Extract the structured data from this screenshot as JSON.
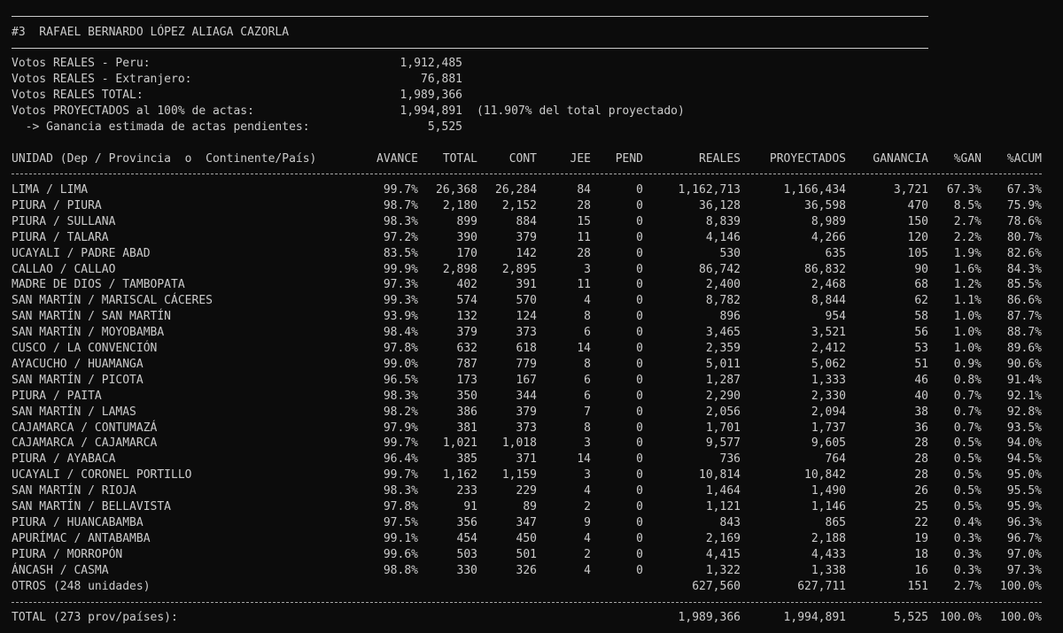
{
  "header": {
    "candidate_title": "#3  RAFAEL BERNARDO LÓPEZ ALIAGA CAZORLA"
  },
  "summary": [
    {
      "label": "Votos REALES - Peru:",
      "value": "1,912,485",
      "note": ""
    },
    {
      "label": "Votos REALES - Extranjero:",
      "value": "76,881",
      "note": ""
    },
    {
      "label": "Votos REALES TOTAL:",
      "value": "1,989,366",
      "note": ""
    },
    {
      "label": "Votos PROYECTADOS al 100% de actas:",
      "value": "1,994,891",
      "note": "(11.907% del total proyectado)"
    },
    {
      "label": "  -> Ganancia estimada de actas pendientes:",
      "value": "5,525",
      "note": ""
    }
  ],
  "table": {
    "headers": {
      "unidad": "UNIDAD (Dep / Provincia  o  Continente/País)",
      "avance": "AVANCE",
      "total": "TOTAL",
      "cont": "CONT",
      "jee": "JEE",
      "pend": "PEND",
      "reales": "REALES",
      "proyectados": "PROYECTADOS",
      "ganancia": "GANANCIA",
      "pgan": "%GAN",
      "pacum": "%ACUM"
    },
    "rows": [
      [
        "LIMA / LIMA",
        "99.7%",
        "26,368",
        "26,284",
        "84",
        "0",
        "1,162,713",
        "1,166,434",
        "3,721",
        "67.3%",
        "67.3%"
      ],
      [
        "PIURA / PIURA",
        "98.7%",
        "2,180",
        "2,152",
        "28",
        "0",
        "36,128",
        "36,598",
        "470",
        "8.5%",
        "75.9%"
      ],
      [
        "PIURA / SULLANA",
        "98.3%",
        "899",
        "884",
        "15",
        "0",
        "8,839",
        "8,989",
        "150",
        "2.7%",
        "78.6%"
      ],
      [
        "PIURA / TALARA",
        "97.2%",
        "390",
        "379",
        "11",
        "0",
        "4,146",
        "4,266",
        "120",
        "2.2%",
        "80.7%"
      ],
      [
        "UCAYALI / PADRE ABAD",
        "83.5%",
        "170",
        "142",
        "28",
        "0",
        "530",
        "635",
        "105",
        "1.9%",
        "82.6%"
      ],
      [
        "CALLAO / CALLAO",
        "99.9%",
        "2,898",
        "2,895",
        "3",
        "0",
        "86,742",
        "86,832",
        "90",
        "1.6%",
        "84.3%"
      ],
      [
        "MADRE DE DIOS / TAMBOPATA",
        "97.3%",
        "402",
        "391",
        "11",
        "0",
        "2,400",
        "2,468",
        "68",
        "1.2%",
        "85.5%"
      ],
      [
        "SAN MARTÍN / MARISCAL CÁCERES",
        "99.3%",
        "574",
        "570",
        "4",
        "0",
        "8,782",
        "8,844",
        "62",
        "1.1%",
        "86.6%"
      ],
      [
        "SAN MARTÍN / SAN MARTÍN",
        "93.9%",
        "132",
        "124",
        "8",
        "0",
        "896",
        "954",
        "58",
        "1.0%",
        "87.7%"
      ],
      [
        "SAN MARTÍN / MOYOBAMBA",
        "98.4%",
        "379",
        "373",
        "6",
        "0",
        "3,465",
        "3,521",
        "56",
        "1.0%",
        "88.7%"
      ],
      [
        "CUSCO / LA CONVENCIÓN",
        "97.8%",
        "632",
        "618",
        "14",
        "0",
        "2,359",
        "2,412",
        "53",
        "1.0%",
        "89.6%"
      ],
      [
        "AYACUCHO / HUAMANGA",
        "99.0%",
        "787",
        "779",
        "8",
        "0",
        "5,011",
        "5,062",
        "51",
        "0.9%",
        "90.6%"
      ],
      [
        "SAN MARTÍN / PICOTA",
        "96.5%",
        "173",
        "167",
        "6",
        "0",
        "1,287",
        "1,333",
        "46",
        "0.8%",
        "91.4%"
      ],
      [
        "PIURA / PAITA",
        "98.3%",
        "350",
        "344",
        "6",
        "0",
        "2,290",
        "2,330",
        "40",
        "0.7%",
        "92.1%"
      ],
      [
        "SAN MARTÍN / LAMAS",
        "98.2%",
        "386",
        "379",
        "7",
        "0",
        "2,056",
        "2,094",
        "38",
        "0.7%",
        "92.8%"
      ],
      [
        "CAJAMARCA / CONTUMAZÁ",
        "97.9%",
        "381",
        "373",
        "8",
        "0",
        "1,701",
        "1,737",
        "36",
        "0.7%",
        "93.5%"
      ],
      [
        "CAJAMARCA / CAJAMARCA",
        "99.7%",
        "1,021",
        "1,018",
        "3",
        "0",
        "9,577",
        "9,605",
        "28",
        "0.5%",
        "94.0%"
      ],
      [
        "PIURA / AYABACA",
        "96.4%",
        "385",
        "371",
        "14",
        "0",
        "736",
        "764",
        "28",
        "0.5%",
        "94.5%"
      ],
      [
        "UCAYALI / CORONEL PORTILLO",
        "99.7%",
        "1,162",
        "1,159",
        "3",
        "0",
        "10,814",
        "10,842",
        "28",
        "0.5%",
        "95.0%"
      ],
      [
        "SAN MARTÍN / RIOJA",
        "98.3%",
        "233",
        "229",
        "4",
        "0",
        "1,464",
        "1,490",
        "26",
        "0.5%",
        "95.5%"
      ],
      [
        "SAN MARTÍN / BELLAVISTA",
        "97.8%",
        "91",
        "89",
        "2",
        "0",
        "1,121",
        "1,146",
        "25",
        "0.5%",
        "95.9%"
      ],
      [
        "PIURA / HUANCABAMBA",
        "97.5%",
        "356",
        "347",
        "9",
        "0",
        "843",
        "865",
        "22",
        "0.4%",
        "96.3%"
      ],
      [
        "APURÍMAC / ANTABAMBA",
        "99.1%",
        "454",
        "450",
        "4",
        "0",
        "2,169",
        "2,188",
        "19",
        "0.3%",
        "96.7%"
      ],
      [
        "PIURA / MORROPÓN",
        "99.6%",
        "503",
        "501",
        "2",
        "0",
        "4,415",
        "4,433",
        "18",
        "0.3%",
        "97.0%"
      ],
      [
        "ÁNCASH / CASMA",
        "98.8%",
        "330",
        "326",
        "4",
        "0",
        "1,322",
        "1,338",
        "16",
        "0.3%",
        "97.3%"
      ],
      [
        "OTROS (248 unidades)",
        "",
        "",
        "",
        "",
        "",
        "627,560",
        "627,711",
        "151",
        "2.7%",
        "100.0%"
      ]
    ],
    "total_row": [
      "TOTAL (273 prov/países):",
      "",
      "",
      "",
      "",
      "",
      "1,989,366",
      "1,994,891",
      "5,525",
      "100.0%",
      "100.0%"
    ]
  },
  "colors": {
    "background": "#0c0c0c",
    "foreground": "#cccccc"
  }
}
